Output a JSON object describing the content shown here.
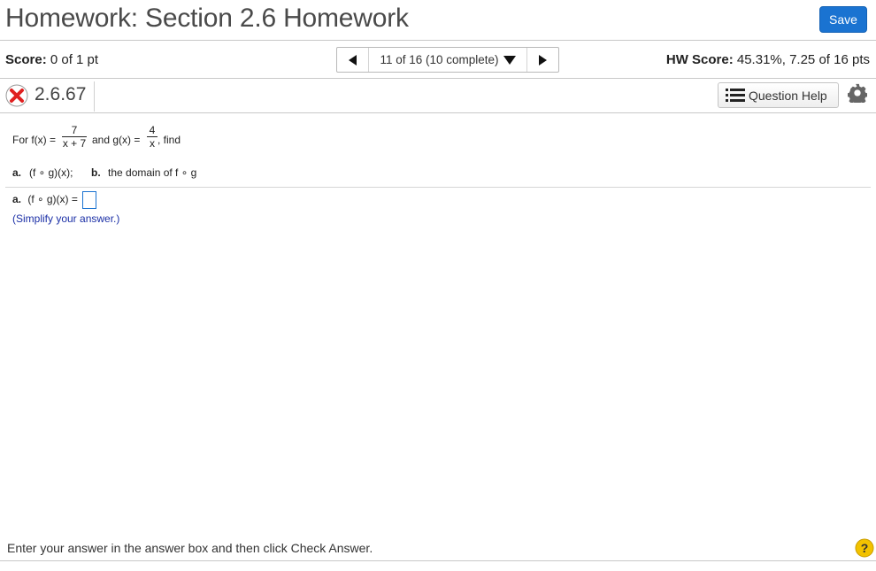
{
  "header": {
    "title": "Homework: Section 2.6 Homework",
    "save_label": "Save"
  },
  "scorebar": {
    "score_label": "Score:",
    "score_value": "0 of 1 pt",
    "nav_text": "11 of 16 (10 complete)",
    "hw_score_label": "HW Score:",
    "hw_score_value": "45.31%, 7.25 of 16 pts"
  },
  "question": {
    "status_icon": "incorrect-x-icon",
    "number": "2.6.67",
    "help_label": "Question Help",
    "settings_icon": "gear-icon"
  },
  "problem": {
    "for_label": "For f(x) =",
    "f_num": "7",
    "f_den": "x + 7",
    "and_label": "and g(x) =",
    "g_num": "4",
    "g_den": "x",
    "find_label": ", find",
    "part_a_label": "a.",
    "part_a_text": "(f ∘ g)(x);",
    "part_b_label": "b.",
    "part_b_text": "the domain of f ∘ g"
  },
  "answer": {
    "a_label": "a.",
    "a_expr": "(f ∘ g)(x) =",
    "hint": "(Simplify your answer.)"
  },
  "footer": {
    "instructions": "Enter your answer in the answer box and then click Check Answer.",
    "help_icon": "question-mark-icon"
  },
  "colors": {
    "accent": "#1a73d1",
    "incorrect": "#e02020",
    "hint": "#1b2fa6",
    "help_yellow": "#f2c200"
  }
}
